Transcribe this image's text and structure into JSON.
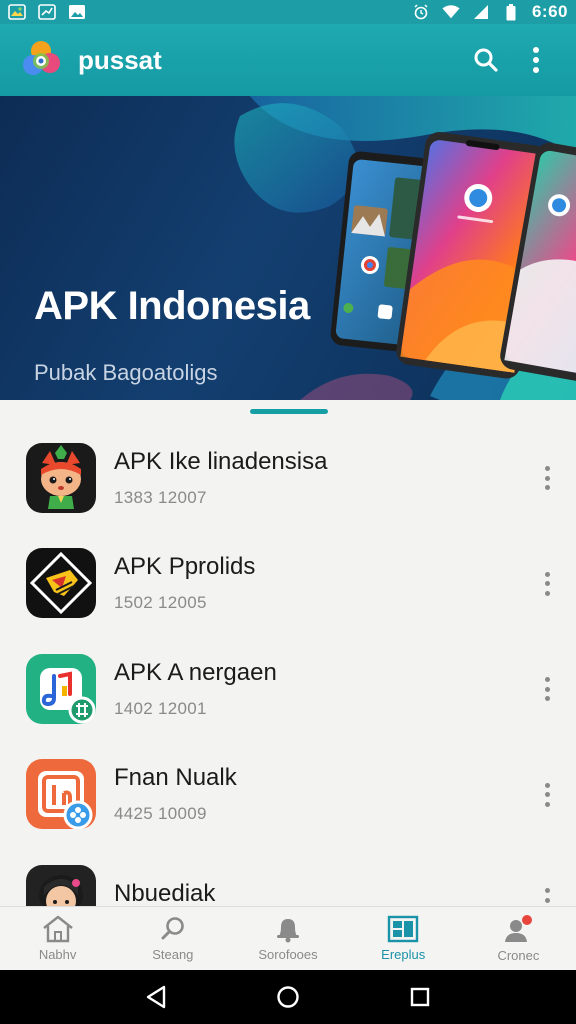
{
  "status_bar": {
    "time": "6:60",
    "left_icons": [
      "notification-image-icon",
      "chart-icon",
      "photo-icon"
    ],
    "right_icons": [
      "alarm-icon",
      "wifi-icon",
      "signal-icon",
      "battery-icon"
    ]
  },
  "app_bar": {
    "title": "pussat",
    "actions": [
      "search-icon",
      "more-vert-icon"
    ]
  },
  "hero": {
    "title": "APK Indonesia",
    "subtitle": "Pubak Bagoatoligs"
  },
  "apps": [
    {
      "name": "APK Ike linadensisa",
      "meta": "1383 12007",
      "icon": "fox-character-icon",
      "icon_bg": "#1a1a1a"
    },
    {
      "name": "APK Pprolids",
      "meta": "1502 12005",
      "icon": "yellow-diamond-icon",
      "icon_bg": "#111111"
    },
    {
      "name": "APK A nergaen",
      "meta": "1402 12001",
      "icon": "music-note-icon",
      "icon_bg": "#21b183"
    },
    {
      "name": "Fnan Nualk",
      "meta": "4425 10009",
      "icon": "orange-app-icon",
      "icon_bg": "#ee6a3c"
    },
    {
      "name": "Nbuediak",
      "meta": "",
      "icon": "avatar-girl-icon",
      "icon_bg": "#222222"
    }
  ],
  "bottom_nav": {
    "items": [
      {
        "label": "Nabhv",
        "icon": "home-icon",
        "active": false
      },
      {
        "label": "Steang",
        "icon": "search-icon",
        "active": false
      },
      {
        "label": "Sorofooes",
        "icon": "bell-icon",
        "active": false
      },
      {
        "label": "Ereplus",
        "icon": "grid-icon",
        "active": true
      },
      {
        "label": "Cronec",
        "icon": "profile-icon",
        "active": false
      }
    ]
  },
  "system_nav": [
    "back-icon",
    "home-circle-icon",
    "recents-icon"
  ],
  "colors": {
    "accent": "#1fa9b1",
    "hero_bg": "#0f3461",
    "active_nav": "#1a93a8"
  }
}
